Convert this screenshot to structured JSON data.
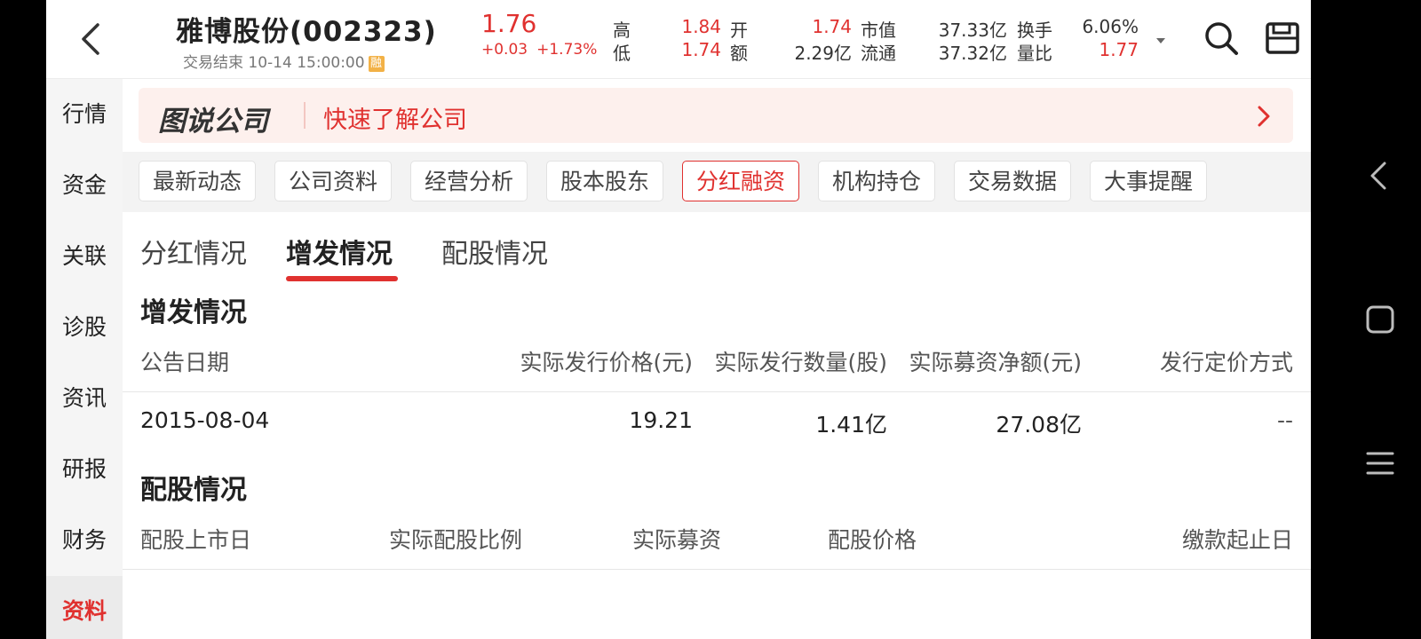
{
  "header": {
    "stock_name": "雅博股份(002323)",
    "status_text": "交易结束 10-14 15:00:00",
    "rong_badge": "融",
    "price": "1.76",
    "change_amount": "+0.03",
    "change_percent": "+1.73%",
    "quotes": {
      "high_label": "高",
      "high_value": "1.84",
      "low_label": "低",
      "low_value": "1.74",
      "open_label": "开",
      "open_value": "1.74",
      "amount_label": "额",
      "amount_value": "2.29亿",
      "mktcap_label": "市值",
      "mktcap_value": "37.33亿",
      "float_label": "流通",
      "float_value": "37.32亿",
      "turnover_label": "换手",
      "turnover_value": "6.06%",
      "volratio_label": "量比",
      "volratio_value": "1.77"
    },
    "icons": [
      "back-icon",
      "caret-down-icon",
      "search-icon",
      "save-icon"
    ]
  },
  "sidebar": {
    "items": [
      {
        "label": "行情"
      },
      {
        "label": "资金"
      },
      {
        "label": "关联"
      },
      {
        "label": "诊股"
      },
      {
        "label": "资讯"
      },
      {
        "label": "研报"
      },
      {
        "label": "财务"
      },
      {
        "label": "资料"
      }
    ],
    "active_index": 7
  },
  "promo": {
    "logo_text": "图说公司",
    "text": "快速了解公司"
  },
  "tabs": {
    "items": [
      {
        "label": "最新动态"
      },
      {
        "label": "公司资料"
      },
      {
        "label": "经营分析"
      },
      {
        "label": "股本股东"
      },
      {
        "label": "分红融资"
      },
      {
        "label": "机构持仓"
      },
      {
        "label": "交易数据"
      },
      {
        "label": "大事提醒"
      }
    ],
    "active_index": 4
  },
  "subtabs": {
    "items": [
      {
        "label": "分红情况"
      },
      {
        "label": "增发情况"
      },
      {
        "label": "配股情况"
      }
    ],
    "active_index": 1
  },
  "additional_issuance": {
    "title": "增发情况",
    "columns": [
      "公告日期",
      "实际发行价格(元)",
      "实际发行数量(股)",
      "实际募资净额(元)",
      "发行定价方式"
    ],
    "rows": [
      [
        "2015-08-04",
        "19.21",
        "1.41亿",
        "27.08亿",
        "--"
      ]
    ]
  },
  "rights_issue": {
    "title": "配股情况",
    "columns": [
      "配股上市日",
      "实际配股比例",
      "实际募资",
      "配股价格",
      "缴款起止日"
    ],
    "rows": []
  },
  "colors": {
    "accent_red": "#e0312f",
    "promo_bg": "#fdf0ed",
    "sidebar_bg": "#f5f5f5"
  }
}
